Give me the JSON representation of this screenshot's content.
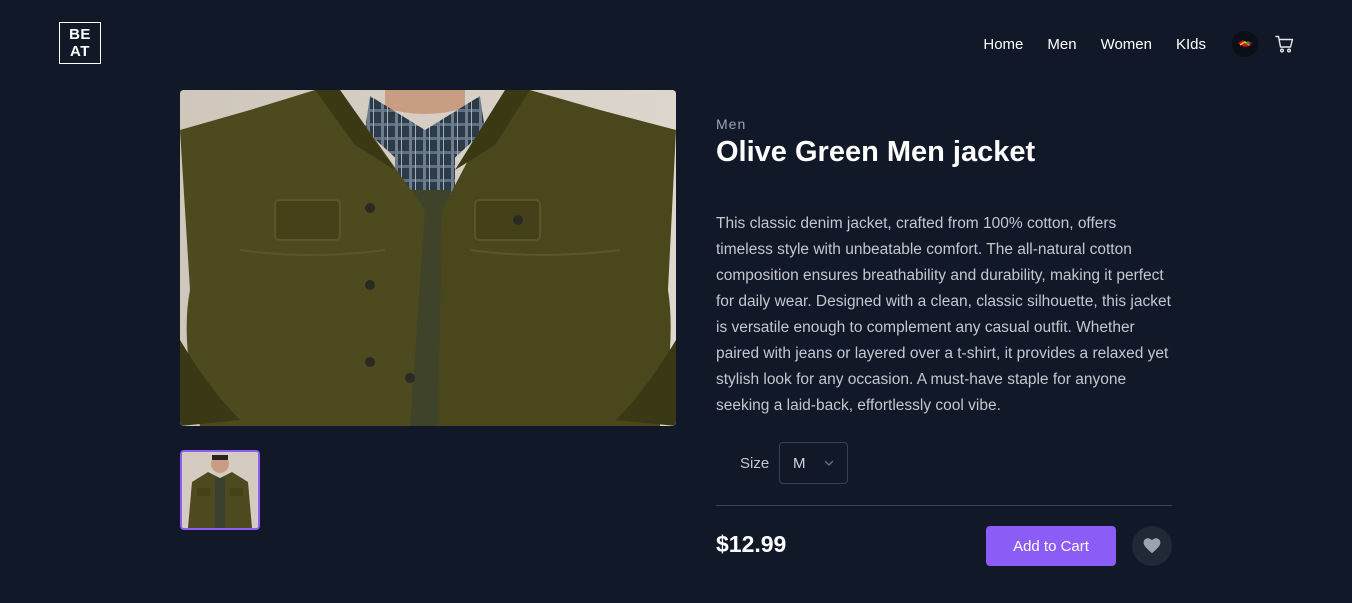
{
  "brand": {
    "line1": "BE",
    "line2": "AT"
  },
  "nav": {
    "items": [
      {
        "label": "Home"
      },
      {
        "label": "Men"
      },
      {
        "label": "Women"
      },
      {
        "label": "KIds"
      }
    ],
    "avatar_icon": "user-avatar-icon",
    "cart_icon": "shopping-cart-icon"
  },
  "product": {
    "category": "Men",
    "title": "Olive Green Men jacket",
    "description": "This classic denim jacket, crafted from 100% cotton, offers timeless style with unbeatable comfort. The all-natural cotton composition ensures breathability and durability, making it perfect for daily wear. Designed with a clean, classic silhouette, this jacket is versatile enough to complement any casual outfit. Whether paired with jeans or layered over a t-shirt, it provides a relaxed yet stylish look for any occasion. A must-have staple for anyone seeking a laid-back, effortlessly cool vibe.",
    "size_label": "Size",
    "size_selected": "M",
    "price": "$12.99",
    "add_to_cart_label": "Add to Cart",
    "favorite_icon": "heart-icon"
  },
  "colors": {
    "background": "#111827",
    "accent": "#8b5cf6",
    "jacket": "#4a4a1c"
  }
}
